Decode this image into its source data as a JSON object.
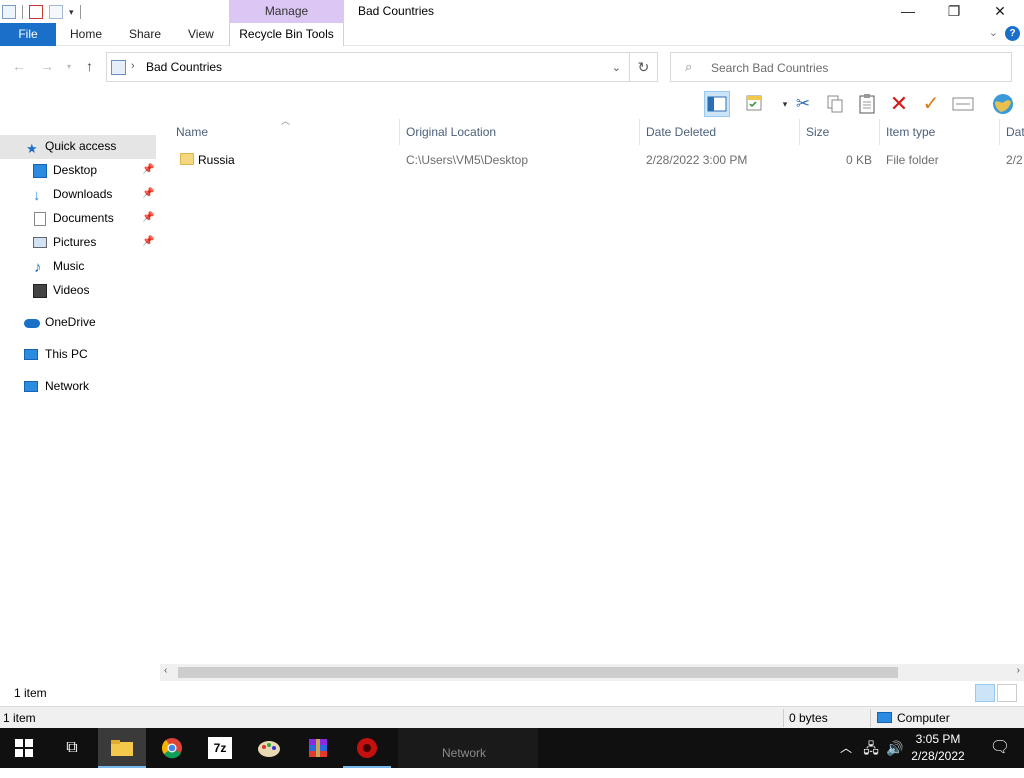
{
  "window": {
    "title": "Bad Countries",
    "context_tab": "Manage",
    "minimize": "—",
    "restore": "❐",
    "close": "✕"
  },
  "ribbon": {
    "tabs": [
      "File",
      "Home",
      "Share",
      "View",
      "Recycle Bin Tools"
    ],
    "help": "?"
  },
  "address_bar": {
    "path": "Bad Countries",
    "separator": "›"
  },
  "search": {
    "placeholder": "Search Bad Countries"
  },
  "nav_pane": {
    "quick_access": "Quick access",
    "pinned": [
      "Desktop",
      "Downloads",
      "Documents",
      "Pictures"
    ],
    "unpinned": [
      "Music",
      "Videos"
    ],
    "onedrive": "OneDrive",
    "this_pc": "This PC",
    "network": "Network"
  },
  "columns": [
    "Name",
    "Original Location",
    "Date Deleted",
    "Size",
    "Item type",
    "Dat"
  ],
  "rows": [
    {
      "name": "Russia",
      "original_location": "C:\\Users\\VM5\\Desktop",
      "date_deleted": "2/28/2022 3:00 PM",
      "size": "0 KB",
      "item_type": "File folder",
      "date_modified": "2/2"
    }
  ],
  "status": {
    "item_count": "1 item",
    "outer_count": "1 item",
    "bytes": "0 bytes",
    "location": "Computer"
  },
  "taskbar": {
    "running_label": "Network",
    "time": "3:05 PM",
    "date": "2/28/2022"
  },
  "colors": {
    "file_tab": "#1a6fc8",
    "manage_tab": "#dcc7f4",
    "quick_access_bg": "#e5e5e5",
    "taskbar": "#101010"
  }
}
